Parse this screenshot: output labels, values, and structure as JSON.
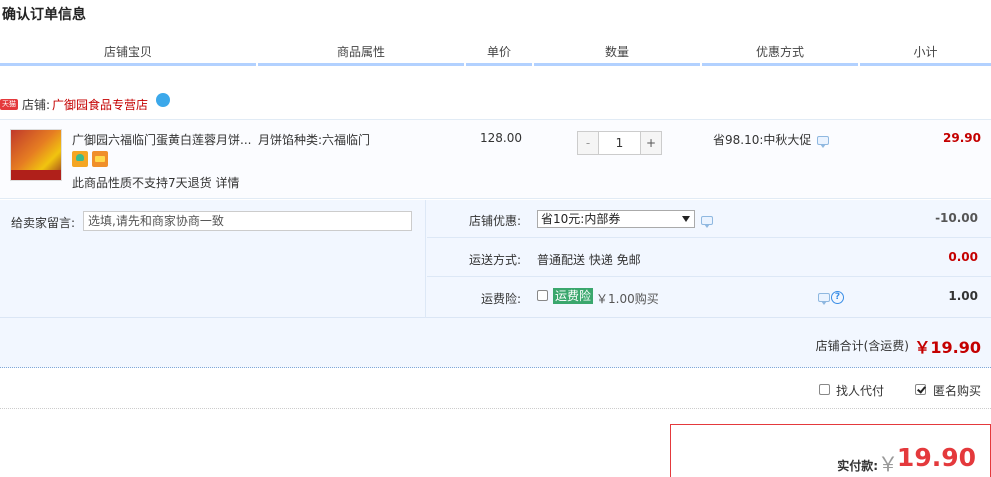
{
  "page": {
    "title": "确认订单信息"
  },
  "columns": [
    "店铺宝贝",
    "商品属性",
    "单价",
    "数量",
    "优惠方式",
    "小计"
  ],
  "shop": {
    "badge": "天猫",
    "label": "店铺:",
    "name": "广御园食品专营店"
  },
  "item": {
    "title": "广御园六福临门蛋黄白莲蓉月饼...",
    "attribute": "月饼馅种类:六福临门",
    "note": "此商品性质不支持7天退货 详情",
    "unit_price": "128.00",
    "quantity": "1",
    "qty_minus": "-",
    "qty_plus": "+",
    "promotion": "省98.10:中秋大促",
    "subtotal": "29.90"
  },
  "message": {
    "label": "给卖家留言:",
    "placeholder": "选填,请先和商家协商一致"
  },
  "shop_discount": {
    "label": "店铺优惠:",
    "selected": "省10元:内部券",
    "value": "-10.00"
  },
  "shipping": {
    "label": "运送方式:",
    "method": "普通配送 快递 免邮",
    "value": "0.00"
  },
  "insurance": {
    "label": "运费险:",
    "tag": "运费险",
    "price": "￥1.00购买",
    "value": "1.00",
    "help": "?"
  },
  "shop_total": {
    "label": "店铺合计(含运费)",
    "amount": "￥19.90"
  },
  "order_options": {
    "proxy_pay": "找人代付",
    "anonymous": "匿名购买"
  },
  "payment": {
    "label": "实付款:",
    "currency": "￥",
    "amount": "19.90"
  },
  "colors": {
    "accent_red": "#c40000",
    "header_border": "#b2d1ff",
    "panel_bg": "#f2f7ff",
    "tmall_red": "#e4393c",
    "insurance_green": "#3aa76d"
  }
}
